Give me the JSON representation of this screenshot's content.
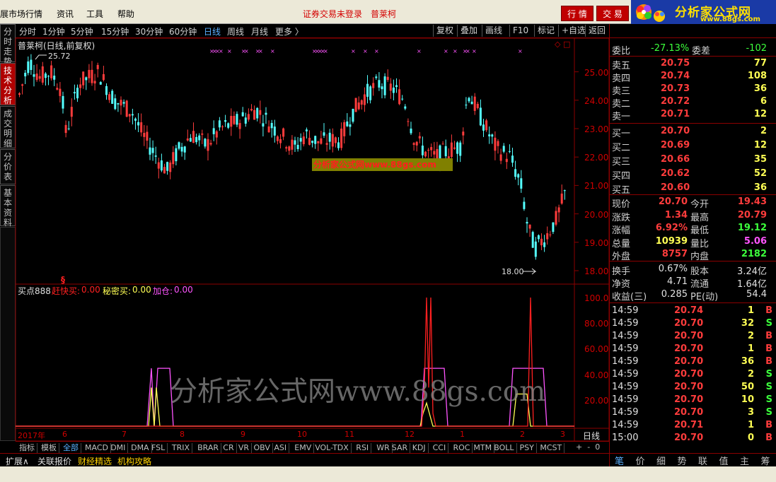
{
  "menu": {
    "items": [
      "展市场行情",
      "资讯",
      "工具",
      "帮助"
    ],
    "login_status": "证券交易未登录",
    "stock_name": "普莱柯",
    "btn_quote": "行 情",
    "btn_trade": "交 易"
  },
  "logo": {
    "title": "分析家公式网",
    "url": "www.88gs.com"
  },
  "periods": [
    "分时",
    "1分钟",
    "5分钟",
    "15分钟",
    "30分钟",
    "60分钟",
    "日线",
    "周线",
    "月线",
    "更多 〉"
  ],
  "active_period": "日线",
  "toolbar_buttons": [
    "复权",
    "叠加",
    "画线",
    "F10",
    "标记",
    "+自选",
    "返回"
  ],
  "side_tabs": [
    {
      "label": "分时走势",
      "active": false
    },
    {
      "label": "技术分析",
      "active": true
    },
    {
      "label": "成交明细",
      "active": false
    },
    {
      "label": "分价表",
      "active": false
    },
    {
      "label": "基本资料",
      "active": false
    }
  ],
  "price_chart": {
    "title": "普莱柯(日线,前复权)",
    "high_label": "25.72",
    "low_label": "18.00",
    "y_ticks": [
      "25.00",
      "24.00",
      "23.00",
      "22.00",
      "21.00",
      "20.00",
      "19.00",
      "18.00"
    ],
    "watermark": "分析家公式网www.88gs.com"
  },
  "indicator": {
    "name": "买点888",
    "line1_label": "赶快买:",
    "line1_value": "0.00",
    "line2_label": "秘密买:",
    "line2_value": "0.00",
    "line3_label": "加仓:",
    "line3_value": "0.00",
    "y_ticks": [
      "100.0",
      "80.00",
      "60.00",
      "40.00",
      "20.00"
    ],
    "watermark": "分析家公式网www.88gs.com"
  },
  "x_axis": {
    "labels": [
      "2017年",
      "6",
      "7",
      "8",
      "9",
      "10",
      "11",
      "12",
      "1",
      "2",
      "3"
    ],
    "period_label": "日线"
  },
  "colors": {
    "up": "#ff3c3c",
    "down": "#54ffff",
    "indicator_red": "#ff2020",
    "indicator_yellow": "#ffff54",
    "indicator_magenta": "#ff54ff",
    "grid": "#8b0000"
  },
  "quote": {
    "ratio": {
      "label": "委比",
      "value": "-27.13%",
      "diff_label": "委差",
      "diff": "-102"
    },
    "asks": [
      {
        "label": "卖五",
        "price": "20.75",
        "vol": "77"
      },
      {
        "label": "卖四",
        "price": "20.74",
        "vol": "108"
      },
      {
        "label": "卖三",
        "price": "20.73",
        "vol": "36"
      },
      {
        "label": "卖二",
        "price": "20.72",
        "vol": "6"
      },
      {
        "label": "卖一",
        "price": "20.71",
        "vol": "12"
      }
    ],
    "bids": [
      {
        "label": "买一",
        "price": "20.70",
        "vol": "2"
      },
      {
        "label": "买二",
        "price": "20.69",
        "vol": "12"
      },
      {
        "label": "买三",
        "price": "20.66",
        "vol": "35"
      },
      {
        "label": "买四",
        "price": "20.62",
        "vol": "52"
      },
      {
        "label": "买五",
        "price": "20.60",
        "vol": "36"
      }
    ],
    "stats": [
      {
        "l1": "现价",
        "v1": "20.70",
        "c1": "#ff3c3c",
        "l2": "今开",
        "v2": "19.43",
        "c2": "#ff3c3c"
      },
      {
        "l1": "涨跌",
        "v1": "1.34",
        "c1": "#ff3c3c",
        "l2": "最高",
        "v2": "20.79",
        "c2": "#ff3c3c"
      },
      {
        "l1": "涨幅",
        "v1": "6.92%",
        "c1": "#ff3c3c",
        "l2": "最低",
        "v2": "19.12",
        "c2": "#3cff3c"
      },
      {
        "l1": "总量",
        "v1": "10939",
        "c1": "#ffff54",
        "l2": "量比",
        "v2": "5.06",
        "c2": "#ff54ff"
      },
      {
        "l1": "外盘",
        "v1": "8757",
        "c1": "#ff3c3c",
        "l2": "内盘",
        "v2": "2182",
        "c2": "#3cff3c"
      }
    ],
    "stats2": [
      {
        "l1": "换手",
        "v1": "0.67%",
        "l2": "股本",
        "v2": "3.24亿"
      },
      {
        "l1": "净资",
        "v1": "4.71",
        "l2": "流通",
        "v2": "1.64亿"
      },
      {
        "l1": "收益(三)",
        "v1": "0.285",
        "l2": "PE(动)",
        "v2": "54.4"
      }
    ],
    "ticks": [
      {
        "time": "14:59",
        "price": "20.74",
        "vol": "1",
        "side": "B"
      },
      {
        "time": "14:59",
        "price": "20.70",
        "vol": "32",
        "side": "S"
      },
      {
        "time": "14:59",
        "price": "20.70",
        "vol": "2",
        "side": "B"
      },
      {
        "time": "14:59",
        "price": "20.70",
        "vol": "1",
        "side": "B"
      },
      {
        "time": "14:59",
        "price": "20.70",
        "vol": "36",
        "side": "B"
      },
      {
        "time": "14:59",
        "price": "20.70",
        "vol": "2",
        "side": "S"
      },
      {
        "time": "14:59",
        "price": "20.70",
        "vol": "50",
        "side": "S"
      },
      {
        "time": "14:59",
        "price": "20.70",
        "vol": "10",
        "side": "S"
      },
      {
        "time": "14:59",
        "price": "20.70",
        "vol": "3",
        "side": "S"
      },
      {
        "time": "14:59",
        "price": "20.71",
        "vol": "1",
        "side": "B"
      },
      {
        "time": "15:00",
        "price": "20.70",
        "vol": "0",
        "side": "B"
      }
    ]
  },
  "indicator_tabs": [
    "指标",
    "模板",
    "全部",
    "MACD",
    "DMI",
    "DMA",
    "FSL",
    "TRIX",
    "BRAR",
    "CR",
    "VR",
    "OBV",
    "ASI",
    "EMV",
    "VOL-TDX",
    "RSI",
    "WR",
    "SAR",
    "KDJ",
    "CCI",
    "ROC",
    "MTM",
    "BOLL",
    "PSY",
    "MCST"
  ],
  "status_tabs": [
    "扩展∧",
    "关联报价",
    "财经精选",
    "机构攻略"
  ],
  "panel_tabs": [
    "笔",
    "价",
    "细",
    "势",
    "联",
    "值",
    "主",
    "筹"
  ],
  "zoom_controls": [
    "+",
    "-",
    "0"
  ]
}
